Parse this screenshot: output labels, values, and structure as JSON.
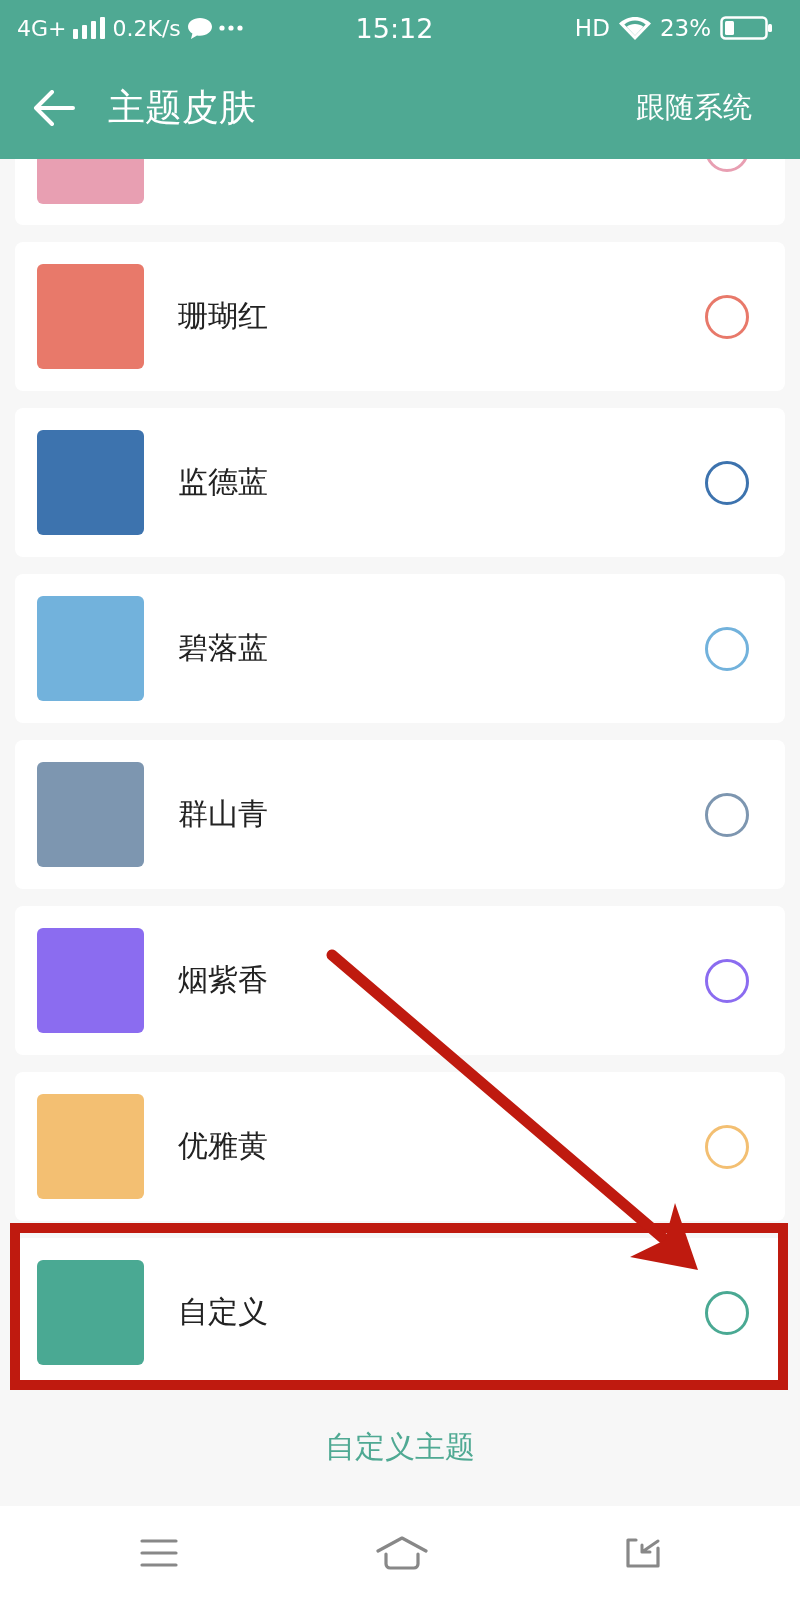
{
  "status_bar": {
    "network": "4G+",
    "speed": "0.2K/s",
    "time": "15:12",
    "hd": "HD",
    "battery": "23%"
  },
  "header": {
    "title": "主题皮肤",
    "action": "跟随系统"
  },
  "themes": [
    {
      "color": "#e89fb2",
      "selected": false,
      "highlighted": false
    },
    {
      "name": "珊瑚红",
      "color": "#e8796a",
      "selected": false,
      "highlighted": false
    },
    {
      "name": "监德蓝",
      "color": "#3d73ae",
      "selected": false,
      "highlighted": false
    },
    {
      "name": "碧落蓝",
      "color": "#72b2dc",
      "selected": false,
      "highlighted": false
    },
    {
      "name": "群山青",
      "color": "#7d96b0",
      "selected": false,
      "highlighted": false
    },
    {
      "name": "烟紫香",
      "color": "#8b6cf0",
      "selected": false,
      "highlighted": false
    },
    {
      "name": "优雅黄",
      "color": "#f3bf72",
      "selected": false,
      "highlighted": false
    },
    {
      "name": "自定义",
      "color": "#4aa993",
      "selected": false,
      "highlighted": true
    }
  ],
  "custom_theme_link": "自定义主题"
}
